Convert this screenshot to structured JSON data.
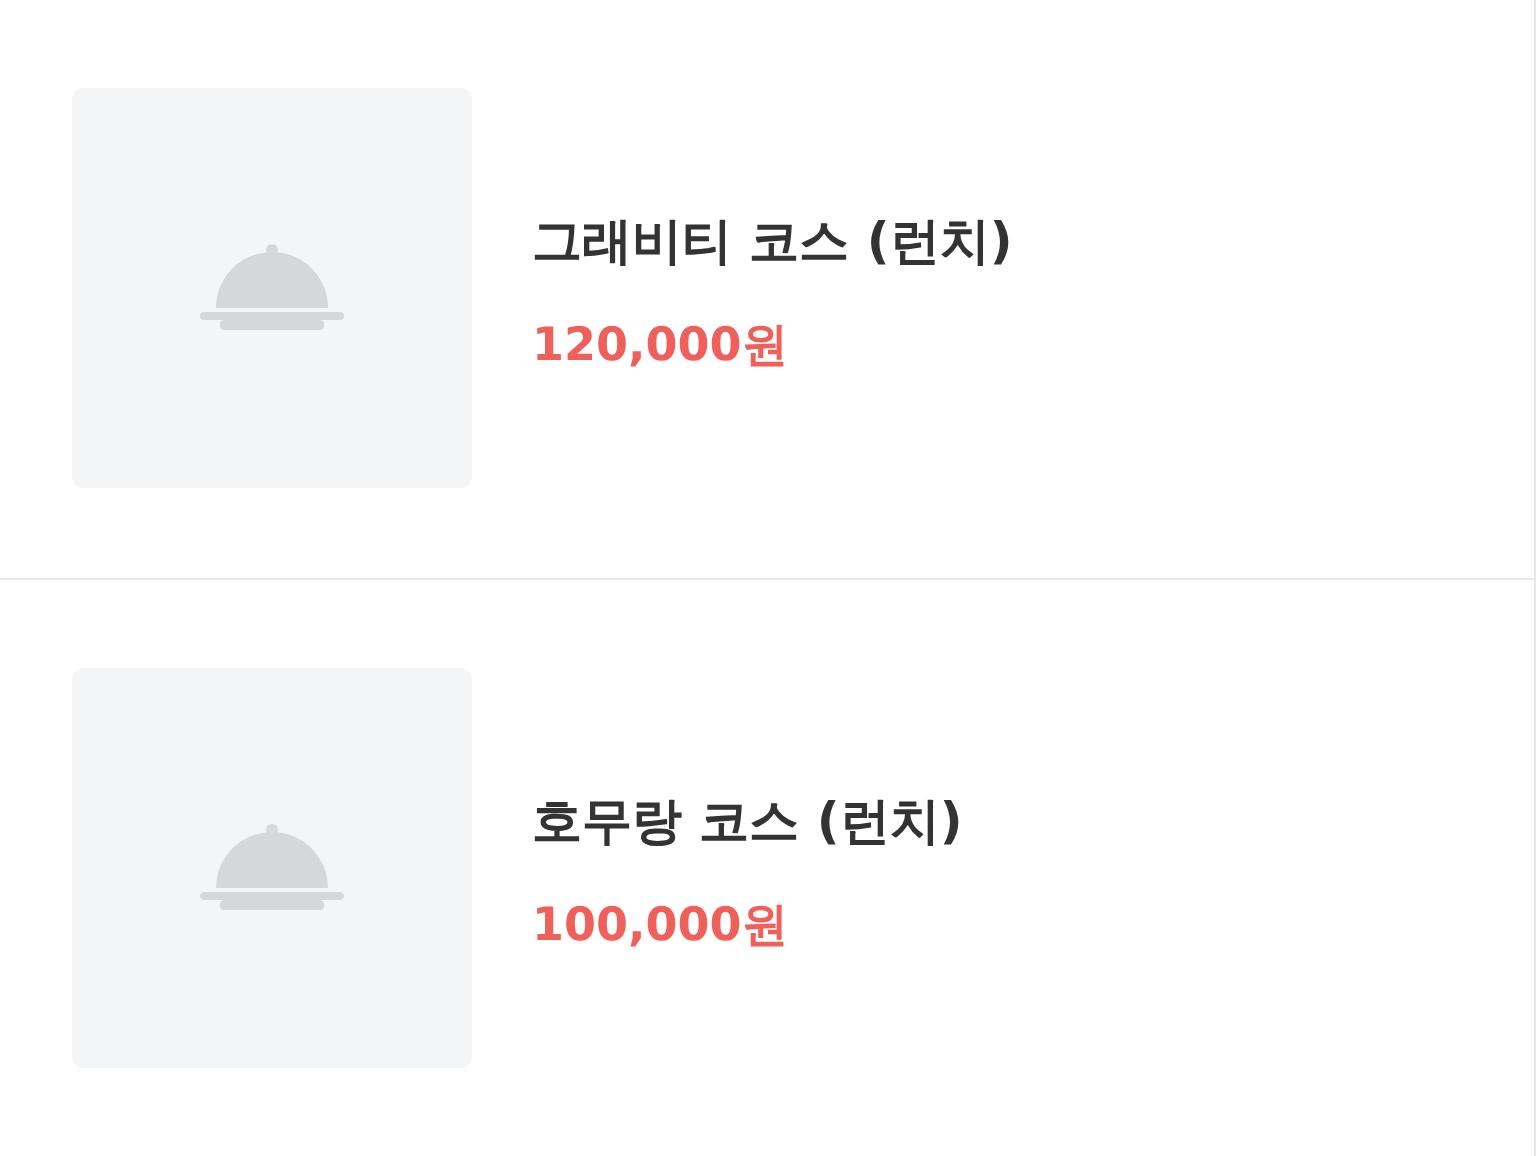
{
  "items": [
    {
      "name": "그래비티 코스 (런치)",
      "price": "120,000원"
    },
    {
      "name": "호무랑 코스 (런치)",
      "price": "100,000원"
    }
  ]
}
